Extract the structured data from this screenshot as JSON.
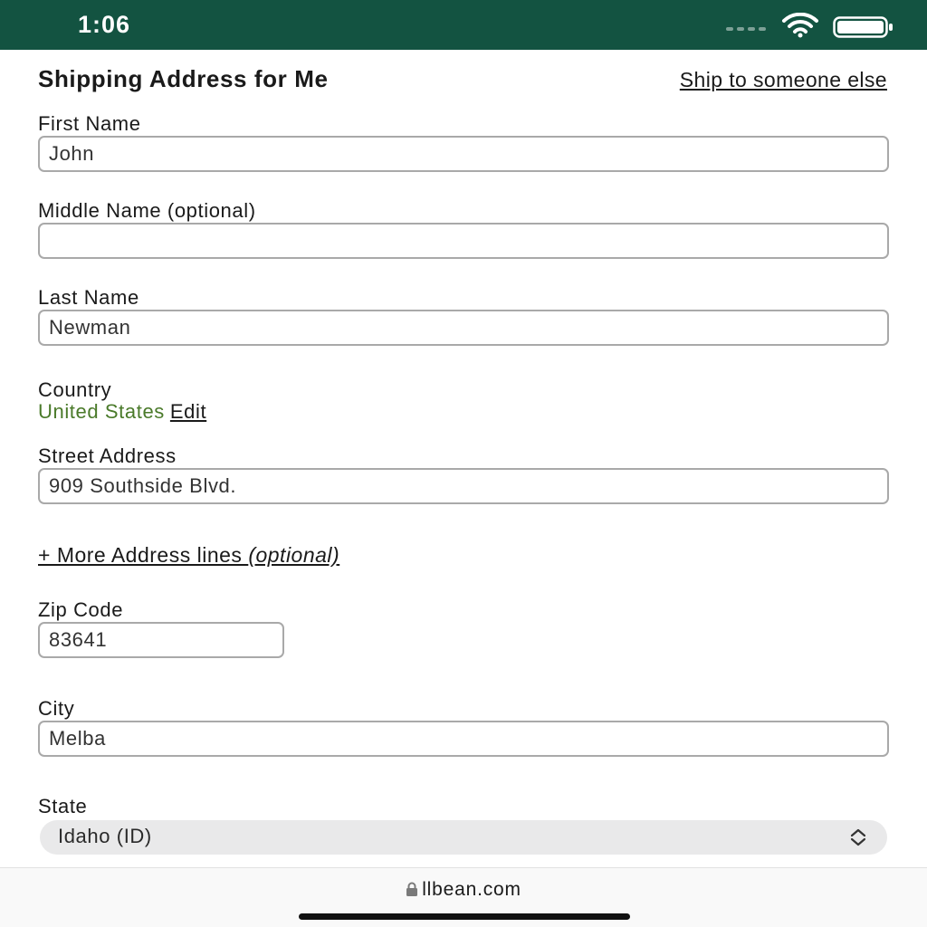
{
  "status_bar": {
    "time": "1:06",
    "background": "#135341",
    "icons": [
      "signal-dots-icon",
      "wifi-icon",
      "battery-icon"
    ]
  },
  "form": {
    "title": "Shipping Address for Me",
    "ship_else_link": "Ship to someone else",
    "first_name": {
      "label": "First Name",
      "value": "John"
    },
    "middle_name": {
      "label": "Middle Name (optional)",
      "value": ""
    },
    "last_name": {
      "label": "Last Name",
      "value": "Newman"
    },
    "country": {
      "label": "Country",
      "value": "United States",
      "edit_label": "Edit",
      "value_color": "#4a7a2a"
    },
    "street": {
      "label": "Street Address",
      "value": "909 Southside Blvd."
    },
    "more_lines": {
      "label": "+ More Address lines ",
      "optional": "(optional)"
    },
    "zip": {
      "label": "Zip Code",
      "value": "83641"
    },
    "city": {
      "label": "City",
      "value": "Melba"
    },
    "state": {
      "label": "State",
      "value": "Idaho (ID)"
    }
  },
  "browser": {
    "url": "llbean.com",
    "icons": [
      "lock-icon"
    ]
  }
}
